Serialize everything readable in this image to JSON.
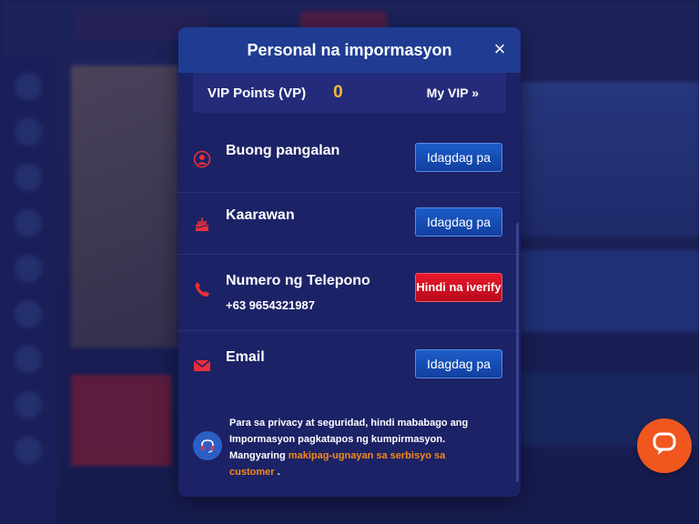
{
  "modal": {
    "title": "Personal na impormasyon",
    "close_label": "×",
    "vip": {
      "label": "VIP Points (VP)",
      "value": "0",
      "link_label": "My VIP »"
    },
    "fields": [
      {
        "label": "Buong pangalan",
        "button_label": "Idagdag pa",
        "icon": "user-icon"
      },
      {
        "label": "Kaarawan",
        "button_label": "Idagdag pa",
        "icon": "cake-icon"
      },
      {
        "label": "Numero ng Telepono",
        "value": "+63 9654321987",
        "button_label": "Hindi na iverify",
        "icon": "phone-icon"
      },
      {
        "label": "Email",
        "button_label": "Idagdag pa",
        "icon": "mail-icon"
      }
    ],
    "notice": {
      "text": "Para sa privacy at seguridad, hindi mababago ang Impormasyon pagkatapos ng kumpirmasyon. Mangyaring",
      "link_text": "makipag-ugnayan sa serbisyo sa customer",
      "suffix": "."
    }
  },
  "colors": {
    "accent": "#f5b93a",
    "link": "#f38a1e",
    "button_blue": "#1b5cc8",
    "button_red": "#e8182a",
    "chat": "#f0571f"
  }
}
